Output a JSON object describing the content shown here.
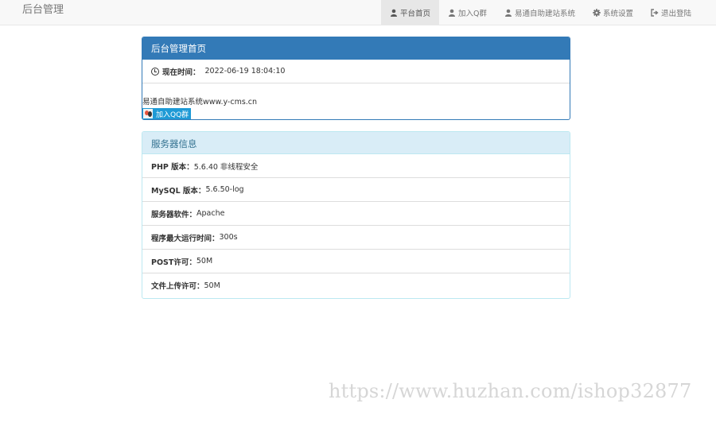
{
  "navbar": {
    "brand": "后台管理",
    "items": [
      {
        "label": "平台首页",
        "icon": "user-icon",
        "active": true
      },
      {
        "label": "加入Q群",
        "icon": "user-icon",
        "active": false
      },
      {
        "label": "易通自助建站系统",
        "icon": "user-icon",
        "active": false
      },
      {
        "label": "系统设置",
        "icon": "gear-icon",
        "active": false
      },
      {
        "label": "退出登陆",
        "icon": "logout-icon",
        "active": false
      }
    ]
  },
  "home_panel": {
    "title": "后台管理首页",
    "time_label": "现在时间：",
    "time_value": "2022-06-19 18:04:10",
    "promo_text": "易通自助建站系统www.y-cms.cn",
    "qq_button": "加入QQ群"
  },
  "server_panel": {
    "title": "服务器信息",
    "rows": [
      {
        "label": "PHP 版本：",
        "value": "5.6.40 非线程安全"
      },
      {
        "label": "MySQL 版本：",
        "value": "5.6.50-log"
      },
      {
        "label": "服务器软件：",
        "value": "Apache"
      },
      {
        "label": "程序最大运行时间：",
        "value": "300s"
      },
      {
        "label": "POST许可：",
        "value": "50M"
      },
      {
        "label": "文件上传许可：",
        "value": "50M"
      }
    ]
  },
  "watermark": "https://www.huzhan.com/ishop32877",
  "colors": {
    "primary": "#337ab7",
    "info_bg": "#d9edf7",
    "info_text": "#31708f",
    "qq_blue": "#1e9ad6"
  }
}
